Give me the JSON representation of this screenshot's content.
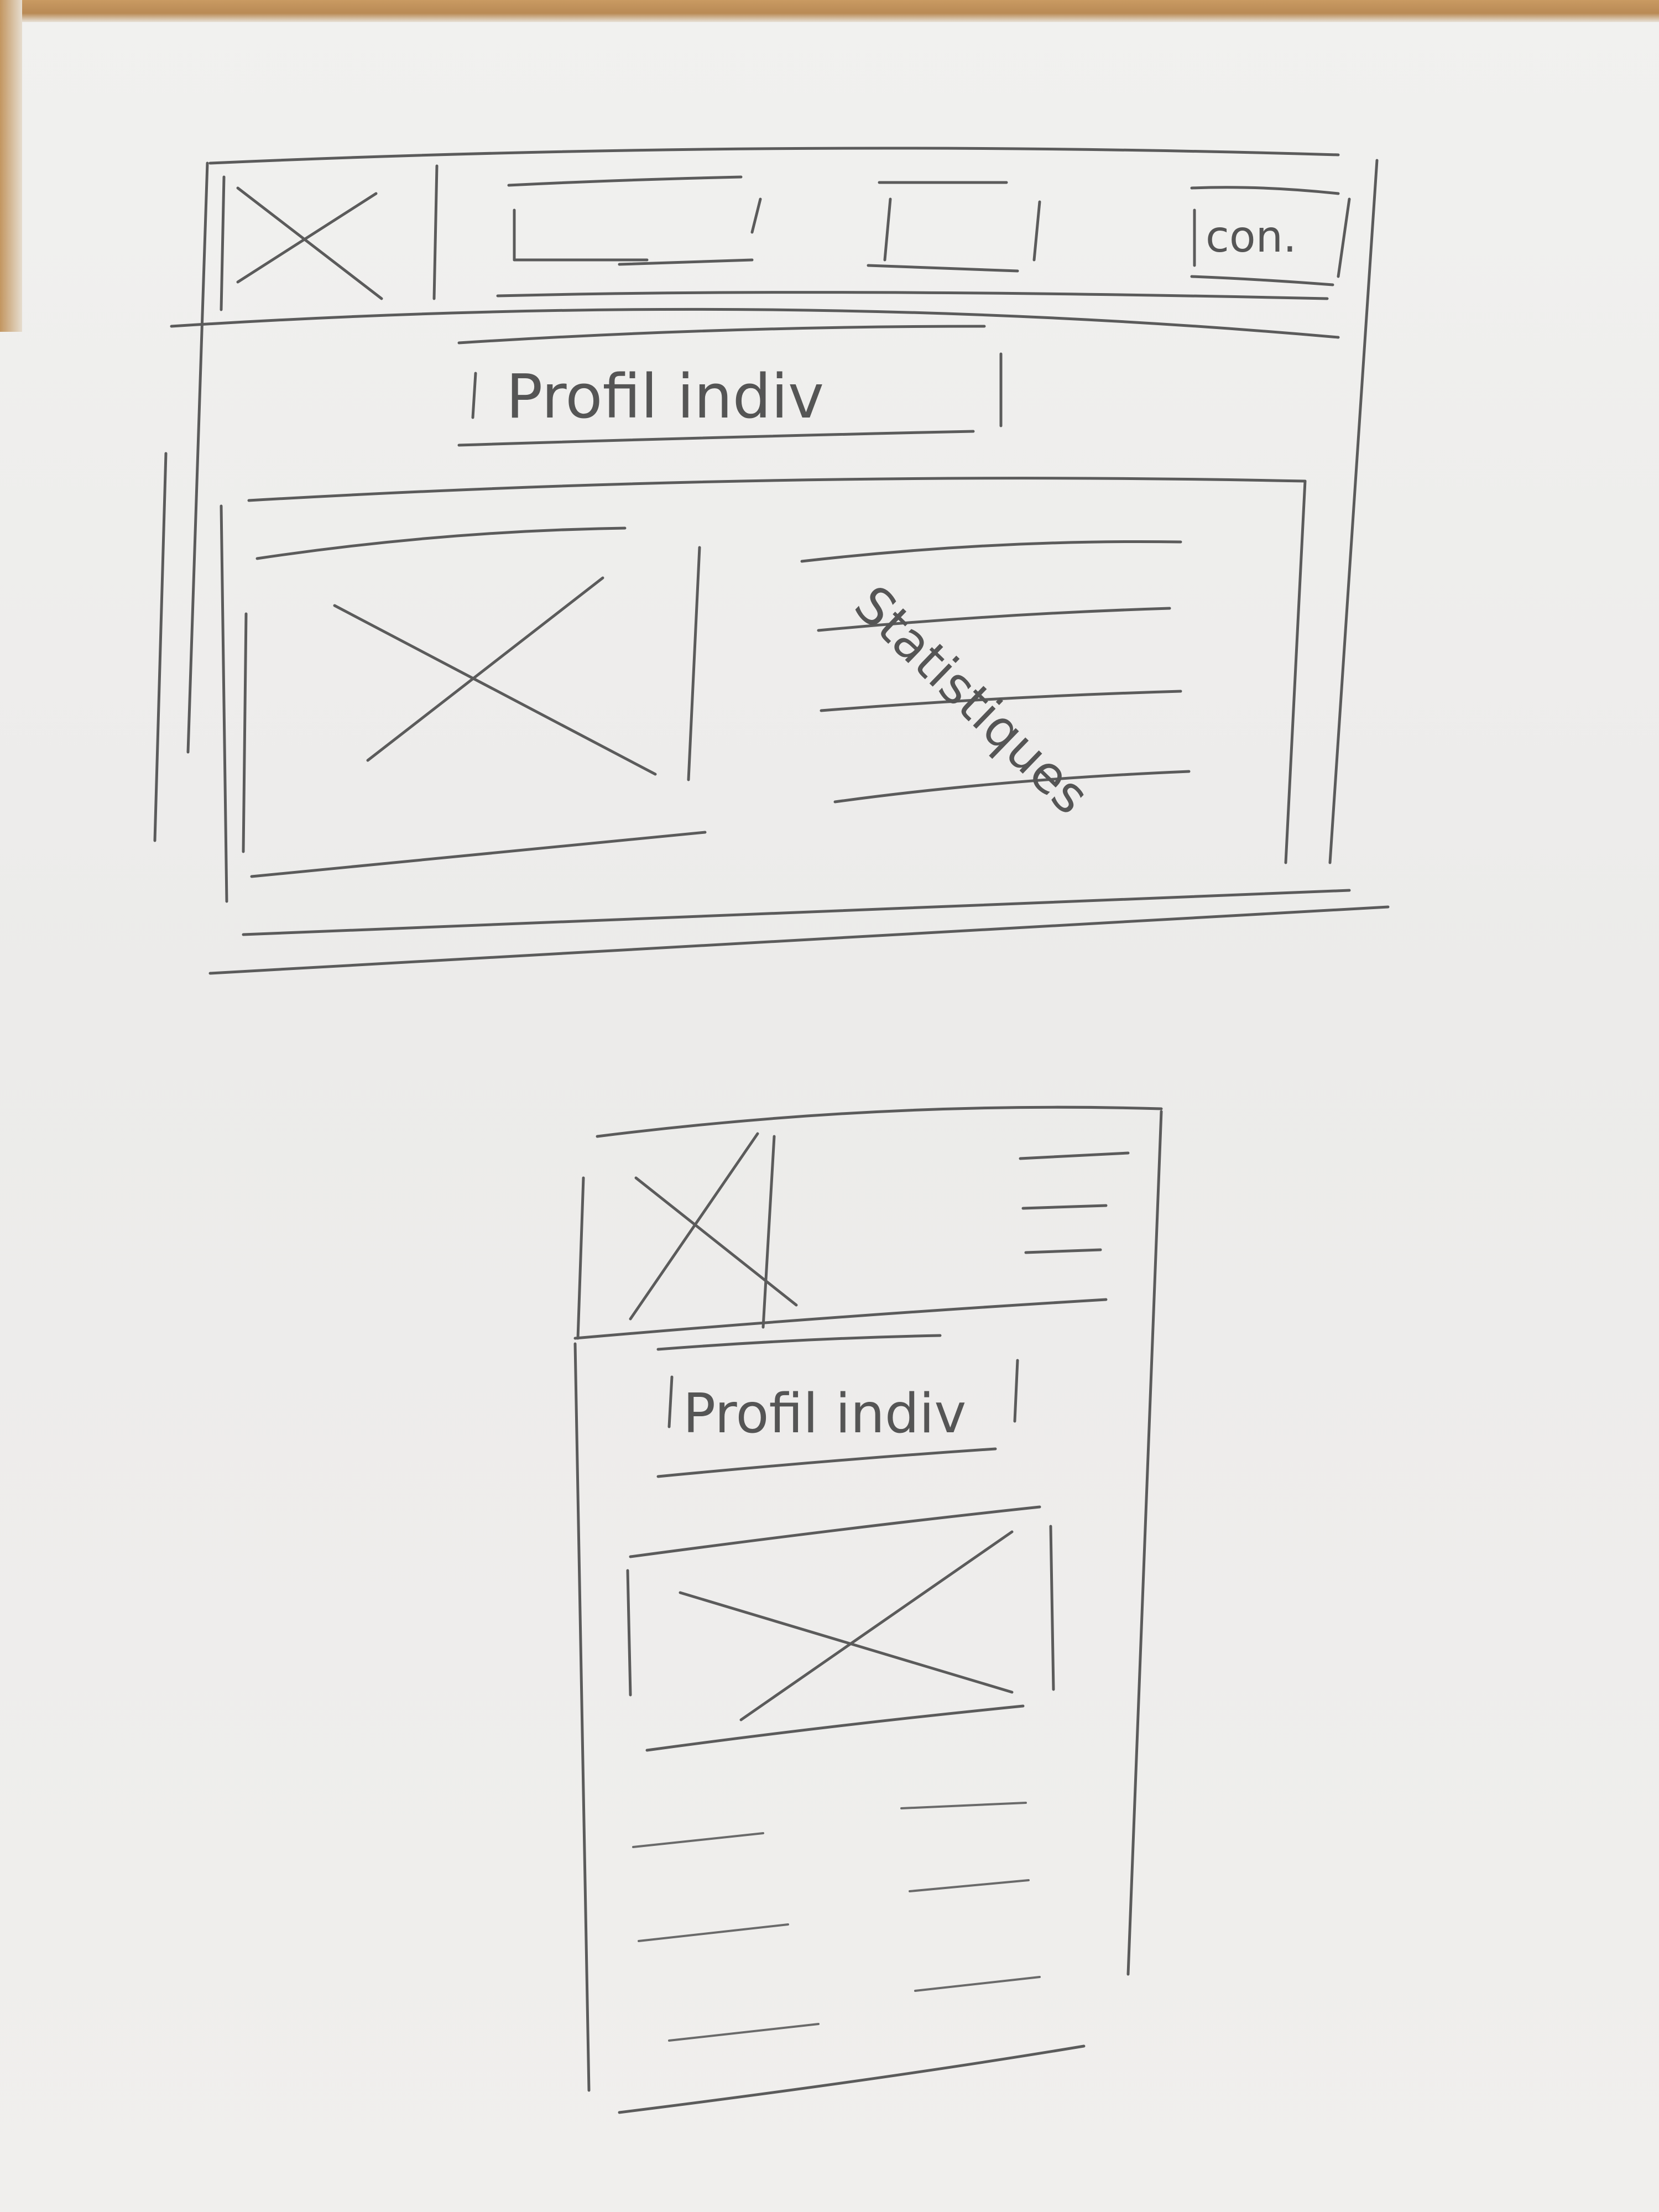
{
  "desktop": {
    "nav_button_label": "con.",
    "title_label": "Profil indiv",
    "stats_label": "Statistiques"
  },
  "mobile": {
    "title_label": "Profil indiv"
  }
}
